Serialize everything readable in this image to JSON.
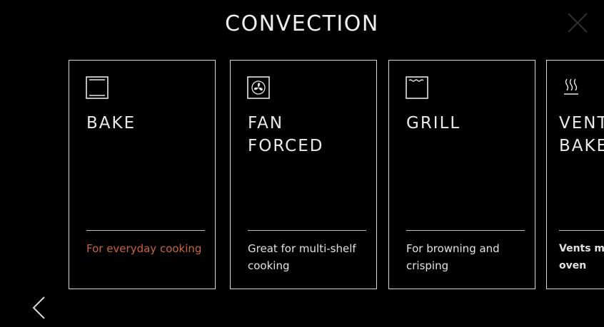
{
  "header": {
    "title": "CONVECTION",
    "close_icon": "close-icon"
  },
  "modes": [
    {
      "id": "bake",
      "icon": "bake-icon",
      "name": "BAKE",
      "description": "For everyday cooking",
      "description_color": "#c9633f"
    },
    {
      "id": "fan-forced",
      "icon": "fan-icon",
      "name": "FAN\nFORCED",
      "description": "Great for multi-shelf cooking"
    },
    {
      "id": "grill",
      "icon": "grill-icon",
      "name": "GRILL",
      "description": "For browning and crisping"
    },
    {
      "id": "vent-bake",
      "icon": "steam-vent-icon",
      "name": "VENT\nBAKE",
      "description": "Vents moisture from oven"
    }
  ],
  "navigation": {
    "back_icon": "chevron-left-icon"
  },
  "colors": {
    "background": "#000000",
    "text": "#e8e8e8",
    "accent": "#c9633f",
    "border": "#d8d8d8"
  }
}
